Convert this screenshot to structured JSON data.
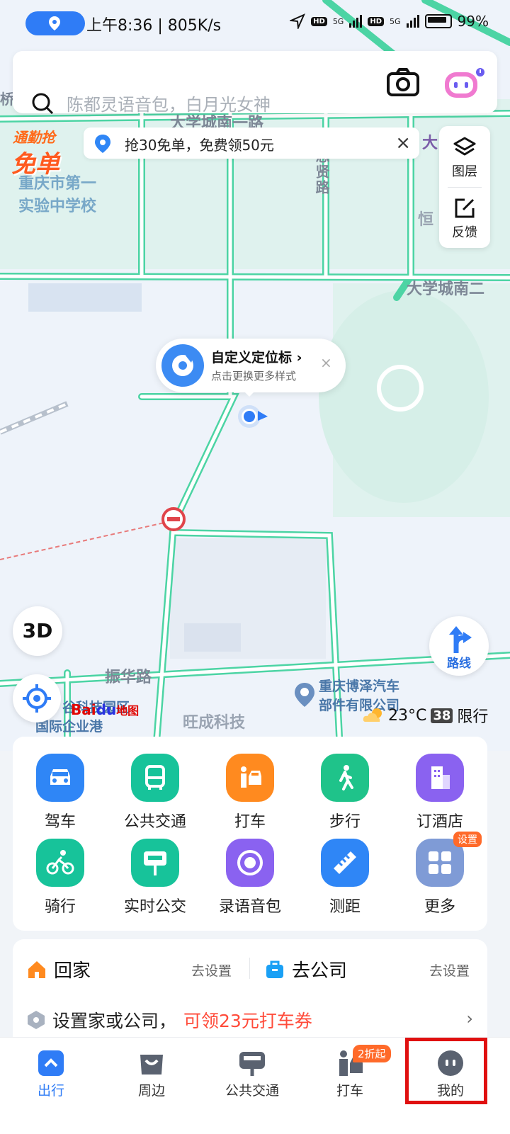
{
  "status_bar": {
    "time": "上午8:36 | 805K/s",
    "network_1": "5G",
    "network_2": "5G",
    "battery": "99%"
  },
  "search": {
    "placeholder": "陈都灵语音包，白月光女神",
    "camera_icon": "camera-icon",
    "assistant_icon": "assistant-robot-icon"
  },
  "promo": {
    "badge_line1": "通勤抢",
    "badge_line2": "免单",
    "text": "抢30免单，免费领50元",
    "close": "×"
  },
  "map_controls": {
    "layers_label": "图层",
    "feedback_label": "反馈",
    "btn_3d": "3D",
    "route_label": "路线"
  },
  "location_bubble": {
    "title": "自定义定位标",
    "title_arrow": "›",
    "subtitle": "点击更换更多样式",
    "close": "×"
  },
  "map_labels": {
    "road_top": "大学城南一路",
    "road_right": "大学城南二",
    "road_vertical": "思贤路",
    "road_bottom": "振华路",
    "school": [
      "重庆市第一",
      "实验中学校"
    ],
    "right_partial": "恒",
    "top_right_partial": "大",
    "top_left_partial": "桥",
    "poi_company": [
      "重庆博泽汽车",
      "部件有限公司"
    ],
    "poi_park": [
      "谷科技园区",
      "国际企业港"
    ],
    "poi_tech": "旺成科技"
  },
  "logo": {
    "bai": "Bai",
    "du": "du",
    "map": "地图"
  },
  "weather": {
    "temp": "23°C",
    "restrict_nums": "38",
    "restrict_label": "限行"
  },
  "grid": [
    {
      "label": "驾车",
      "color": "#2f86f6",
      "icon": "car-icon"
    },
    {
      "label": "公共交通",
      "color": "#17c39a",
      "icon": "bus-icon"
    },
    {
      "label": "打车",
      "color": "#ff8a1f",
      "icon": "taxi-icon"
    },
    {
      "label": "步行",
      "color": "#1fc38a",
      "icon": "walk-icon"
    },
    {
      "label": "订酒店",
      "color": "#8a62f0",
      "icon": "hotel-icon"
    },
    {
      "label": "骑行",
      "color": "#17c39a",
      "icon": "bike-icon"
    },
    {
      "label": "实时公交",
      "color": "#17c39a",
      "icon": "bus-stop-icon"
    },
    {
      "label": "录语音包",
      "color": "#8a62f0",
      "icon": "record-icon"
    },
    {
      "label": "测距",
      "color": "#2f86f6",
      "icon": "ruler-icon"
    },
    {
      "label": "更多",
      "color": "#7f9bd6",
      "icon": "more-grid-icon",
      "tag": "设置"
    }
  ],
  "home_card": {
    "home_label": "回家",
    "home_action": "去设置",
    "work_label": "去公司",
    "work_action": "去设置",
    "tip_prefix": "设置家或公司，",
    "tip_highlight": "可领23元打车券",
    "arrow": "›"
  },
  "tabs": [
    {
      "label": "出行",
      "active": true,
      "icon": "travel-icon"
    },
    {
      "label": "周边",
      "icon": "nearby-icon"
    },
    {
      "label": "公共交通",
      "icon": "transit-icon"
    },
    {
      "label": "打车",
      "icon": "taxi-tab-icon",
      "badge": "2折起"
    },
    {
      "label": "我的",
      "icon": "profile-icon"
    }
  ]
}
